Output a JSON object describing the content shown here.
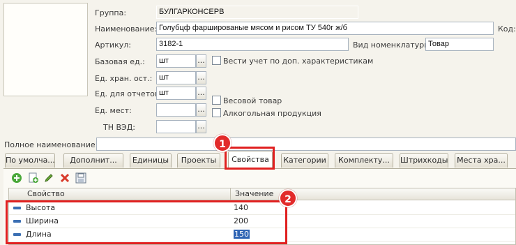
{
  "form": {
    "group_label": "Группа:",
    "group_value": "БУЛГАРКОНСЕРВ",
    "name_label": "Наименование:",
    "name_value": "Голубцф фаршированые мясом и рисом ТУ 540г ж/б",
    "code_label": "Код:",
    "article_label": "Артикул:",
    "article_value": "3182-1",
    "nomenclature_type_label": "Вид номенклатуры:",
    "nomenclature_type_value": "Товар",
    "base_unit_label": "Базовая ед.:",
    "base_unit_value": "шт",
    "track_characteristics_label": "Вести учет по доп. характеристикам",
    "track_characteristics_checked": false,
    "storage_unit_label": "Ед. хран. ост.:",
    "storage_unit_value": "шт",
    "report_unit_label": "Ед. для отчетов:",
    "report_unit_value": "шт",
    "weight_goods_label": "Весовой товар",
    "weight_goods_checked": false,
    "places_unit_label": "Ед. мест:",
    "places_unit_value": "",
    "alcohol_label": "Алкогольная продукция",
    "alcohol_checked": false,
    "tn_ved_label": "ТН ВЭД:",
    "tn_ved_value": "",
    "full_name_label": "Полное наименование:",
    "full_name_value": "",
    "ellipsis": "..."
  },
  "tabs": [
    {
      "label": "По умолча...",
      "active": false
    },
    {
      "label": "Дополнит...",
      "active": false
    },
    {
      "label": "Единицы",
      "active": false
    },
    {
      "label": "Проекты",
      "active": false
    },
    {
      "label": "Свойства",
      "active": true
    },
    {
      "label": "Категории",
      "active": false
    },
    {
      "label": "Комплекту...",
      "active": false
    },
    {
      "label": "Штрихкоды",
      "active": false
    },
    {
      "label": "Места хра...",
      "active": false
    }
  ],
  "toolbar": {
    "icons": [
      "add-icon",
      "copy-icon",
      "edit-icon",
      "delete-icon",
      "save-icon"
    ]
  },
  "properties_table": {
    "columns": [
      "Свойство",
      "Значение"
    ],
    "rows": [
      {
        "property": "Высота",
        "value": "140"
      },
      {
        "property": "Ширина",
        "value": "200"
      },
      {
        "property": "Длина",
        "value": "150"
      }
    ]
  },
  "annotations": {
    "badge1": "1",
    "badge2": "2",
    "color": "#e02020"
  }
}
